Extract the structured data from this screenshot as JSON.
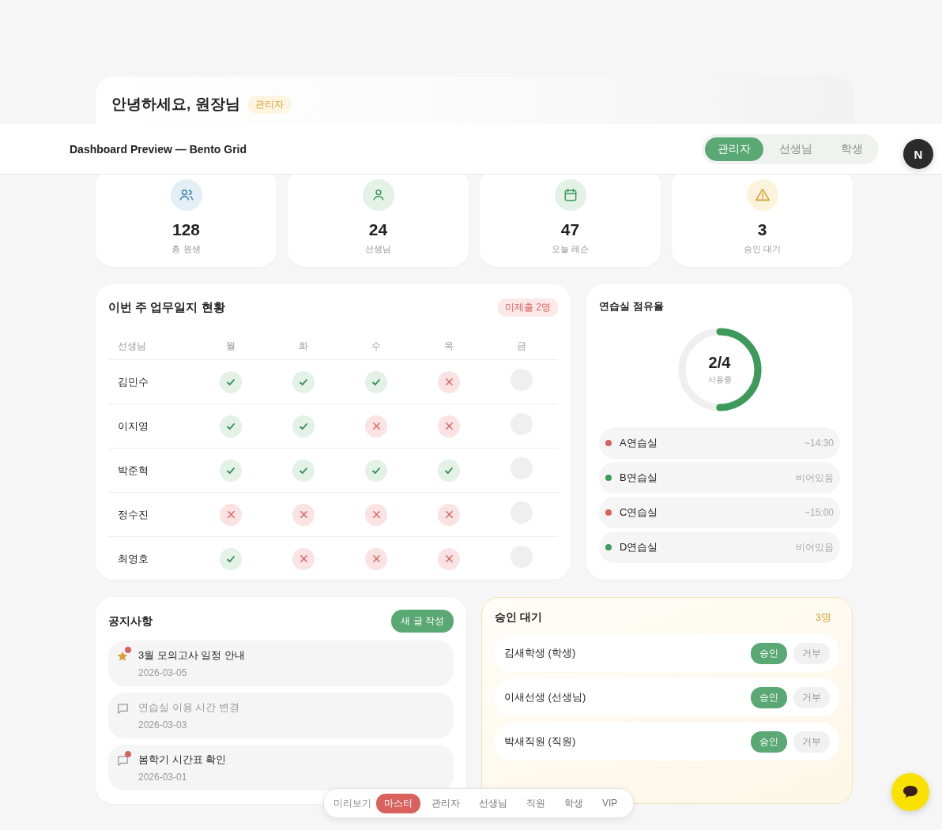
{
  "header": {
    "title": "Dashboard Preview — Bento Grid",
    "role_tabs": [
      {
        "label": "관리자",
        "selected": true
      },
      {
        "label": "선생님",
        "selected": false
      },
      {
        "label": "학생",
        "selected": false
      }
    ],
    "avatar": "N"
  },
  "greeting": {
    "title": "안녕하세요, 원장님",
    "badge": "관리자"
  },
  "stats": [
    {
      "kind": "users",
      "value": "128",
      "label": "총 원생"
    },
    {
      "kind": "user",
      "value": "24",
      "label": "선생님"
    },
    {
      "kind": "calendar",
      "value": "47",
      "label": "오늘 레슨"
    },
    {
      "kind": "warning",
      "value": "3",
      "label": "승인 대기"
    }
  ],
  "journal": {
    "title": "이번 주 업무일지 현황",
    "badge": "미제출 2명",
    "columns": [
      "선생님",
      "월",
      "화",
      "수",
      "목",
      "금"
    ],
    "rows": [
      {
        "name": "김민수",
        "days": [
          {
            "kind": "done"
          },
          {
            "kind": "done"
          },
          {
            "kind": "done"
          },
          {
            "kind": "missed"
          },
          {
            "kind": "empty"
          }
        ]
      },
      {
        "name": "이지영",
        "days": [
          {
            "kind": "done"
          },
          {
            "kind": "done"
          },
          {
            "kind": "missed"
          },
          {
            "kind": "missed"
          },
          {
            "kind": "empty"
          }
        ]
      },
      {
        "name": "박준혁",
        "days": [
          {
            "kind": "done"
          },
          {
            "kind": "done"
          },
          {
            "kind": "done"
          },
          {
            "kind": "done"
          },
          {
            "kind": "empty"
          }
        ]
      },
      {
        "name": "정수진",
        "days": [
          {
            "kind": "missed"
          },
          {
            "kind": "missed"
          },
          {
            "kind": "missed"
          },
          {
            "kind": "missed"
          },
          {
            "kind": "empty"
          }
        ]
      },
      {
        "name": "최영호",
        "days": [
          {
            "kind": "done"
          },
          {
            "kind": "missed"
          },
          {
            "kind": "missed"
          },
          {
            "kind": "missed"
          },
          {
            "kind": "empty"
          }
        ]
      }
    ]
  },
  "rooms": {
    "title": "연습실 점유율",
    "gauge": {
      "value": "2/4",
      "caption": "사용중",
      "level": 0.5
    },
    "items": [
      {
        "name": "A연습실",
        "status": "~14:30",
        "color": "#d9625e"
      },
      {
        "name": "B연습실",
        "status": "비어있음",
        "color": "#3d9a5a"
      },
      {
        "name": "C연습실",
        "status": "~15:00",
        "color": "#d9625e"
      },
      {
        "name": "D연습실",
        "status": "비어있음",
        "color": "#3d9a5a"
      }
    ]
  },
  "notices": {
    "title": "공지사항",
    "button": "새 글 작성",
    "items": [
      {
        "kind": "star",
        "title": "3월 모의고사 일정 안내",
        "date": "2026-03-05",
        "unread": true
      },
      {
        "kind": "comment",
        "title": "연습실 이용 시간 변경",
        "date": "2026-03-03",
        "unread": false
      },
      {
        "kind": "comment",
        "title": "봄학기 시간표 확인",
        "date": "2026-03-01",
        "unread": true
      }
    ]
  },
  "approvals": {
    "title": "승인 대기",
    "count": "3명",
    "items": [
      {
        "name": "김새학생 (학생)",
        "approve": "승인",
        "reject": "거부"
      },
      {
        "name": "이새선생 (선생님)",
        "approve": "승인",
        "reject": "거부"
      },
      {
        "name": "박새직원 (직원)",
        "approve": "승인",
        "reject": "거부"
      }
    ]
  },
  "preview_nav": {
    "label": "미리보기",
    "tabs": [
      {
        "label": "마스터",
        "selected": true
      },
      {
        "label": "관리자",
        "selected": false
      },
      {
        "label": "선생님",
        "selected": false
      },
      {
        "label": "직원",
        "selected": false
      },
      {
        "label": "학생",
        "selected": false
      },
      {
        "label": "VIP",
        "selected": false
      }
    ]
  }
}
